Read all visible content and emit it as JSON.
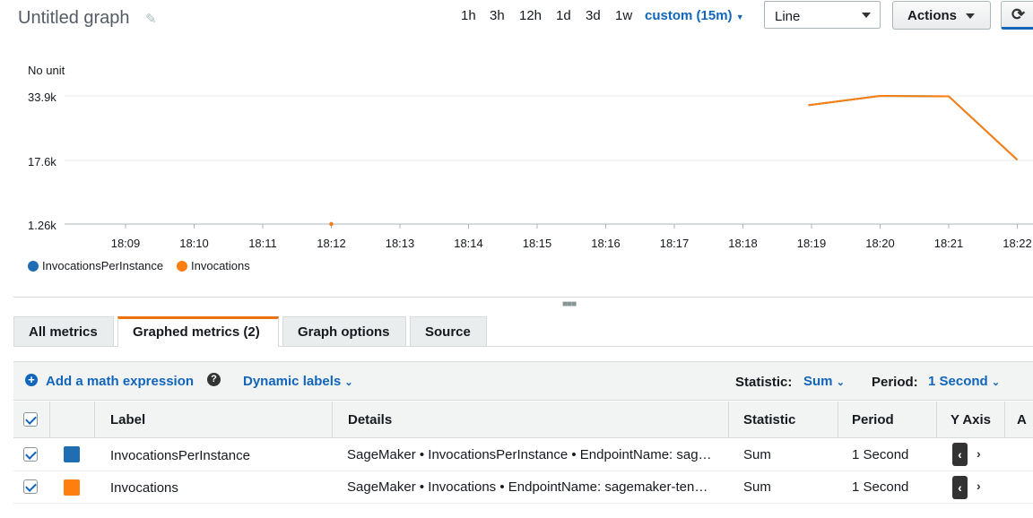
{
  "header": {
    "title": "Untitled graph",
    "ranges": [
      "1h",
      "3h",
      "12h",
      "1d",
      "3d",
      "1w"
    ],
    "custom_range": "custom (15m)",
    "chart_type_select": "Line",
    "actions_label": "Actions"
  },
  "chart_data": {
    "type": "line",
    "unit_label": "No unit",
    "y_ticks": [
      "33.9k",
      "17.6k",
      "1.26k"
    ],
    "ylim": [
      1260,
      33900
    ],
    "x": [
      "18:09",
      "18:10",
      "18:11",
      "18:12",
      "18:13",
      "18:14",
      "18:15",
      "18:16",
      "18:17",
      "18:18",
      "18:19",
      "18:20",
      "18:21",
      "18:22"
    ],
    "series": [
      {
        "name": "InvocationsPerInstance",
        "color": "#1f77b4",
        "values": [
          null,
          null,
          null,
          1260,
          null,
          null,
          null,
          null,
          null,
          null,
          32900,
          33900,
          33800,
          17600
        ]
      },
      {
        "name": "Invocations",
        "color": "#ff7f0e",
        "values": [
          null,
          null,
          null,
          1260,
          null,
          null,
          null,
          null,
          null,
          null,
          32900,
          33900,
          33800,
          17600
        ]
      }
    ],
    "legend_position": "bottom-left",
    "grid": true
  },
  "tabs": [
    "All metrics",
    "Graphed metrics (2)",
    "Graph options",
    "Source"
  ],
  "toolbar": {
    "add_math": "Add a math expression",
    "dynamic_labels": "Dynamic labels",
    "statistic_label": "Statistic:",
    "statistic_value": "Sum",
    "period_label": "Period:",
    "period_value": "1 Second"
  },
  "table": {
    "headers": [
      "Label",
      "Details",
      "Statistic",
      "Period",
      "Y Axis",
      "A"
    ],
    "rows": [
      {
        "label": "InvocationsPerInstance",
        "color": "#1f77b4",
        "details": "SageMaker • InvocationsPerInstance • EndpointName: sag…",
        "statistic": "Sum",
        "period": "1 Second"
      },
      {
        "label": "Invocations",
        "color": "#ff7f0e",
        "details": "SageMaker • Invocations • EndpointName: sagemaker-ten…",
        "statistic": "Sum",
        "period": "1 Second"
      }
    ]
  }
}
